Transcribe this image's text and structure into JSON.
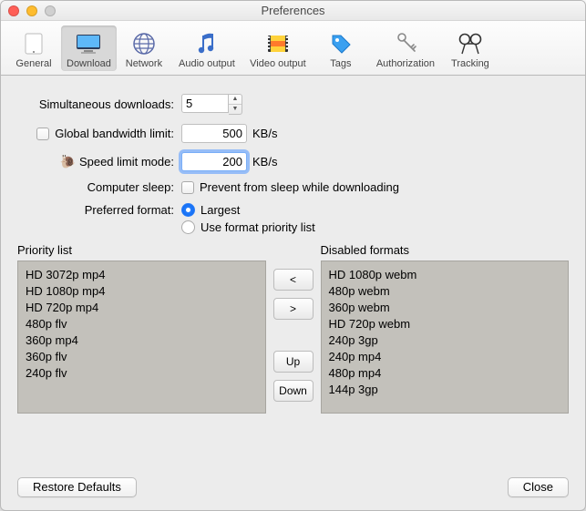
{
  "window": {
    "title": "Preferences"
  },
  "toolbar": {
    "items": [
      {
        "label": "General"
      },
      {
        "label": "Download"
      },
      {
        "label": "Network"
      },
      {
        "label": "Audio output"
      },
      {
        "label": "Video output"
      },
      {
        "label": "Tags"
      },
      {
        "label": "Authorization"
      },
      {
        "label": "Tracking"
      }
    ],
    "selected": "Download"
  },
  "form": {
    "simultaneous_label": "Simultaneous downloads:",
    "simultaneous_value": "5",
    "bandwidth_label": "Global bandwidth limit:",
    "bandwidth_value": "500",
    "speed_label": "Speed limit mode:",
    "speed_value": "200",
    "sleep_label": "Computer sleep:",
    "sleep_check_label": "Prevent from sleep while downloading",
    "format_label": "Preferred format:",
    "format_opt1": "Largest",
    "format_opt2": "Use format priority list",
    "unit": "KB/s"
  },
  "lists": {
    "priority_title": "Priority list",
    "disabled_title": "Disabled formats",
    "priority": [
      "HD 3072p mp4",
      "HD 1080p mp4",
      "HD 720p mp4",
      "480p flv",
      "360p mp4",
      "360p flv",
      "240p flv"
    ],
    "disabled": [
      "HD 1080p webm",
      "480p webm",
      "360p webm",
      "HD 720p webm",
      "240p 3gp",
      "240p mp4",
      "480p mp4",
      "144p 3gp"
    ]
  },
  "buttons": {
    "move_left": "<",
    "move_right": ">",
    "up": "Up",
    "down": "Down",
    "restore": "Restore Defaults",
    "close": "Close"
  }
}
